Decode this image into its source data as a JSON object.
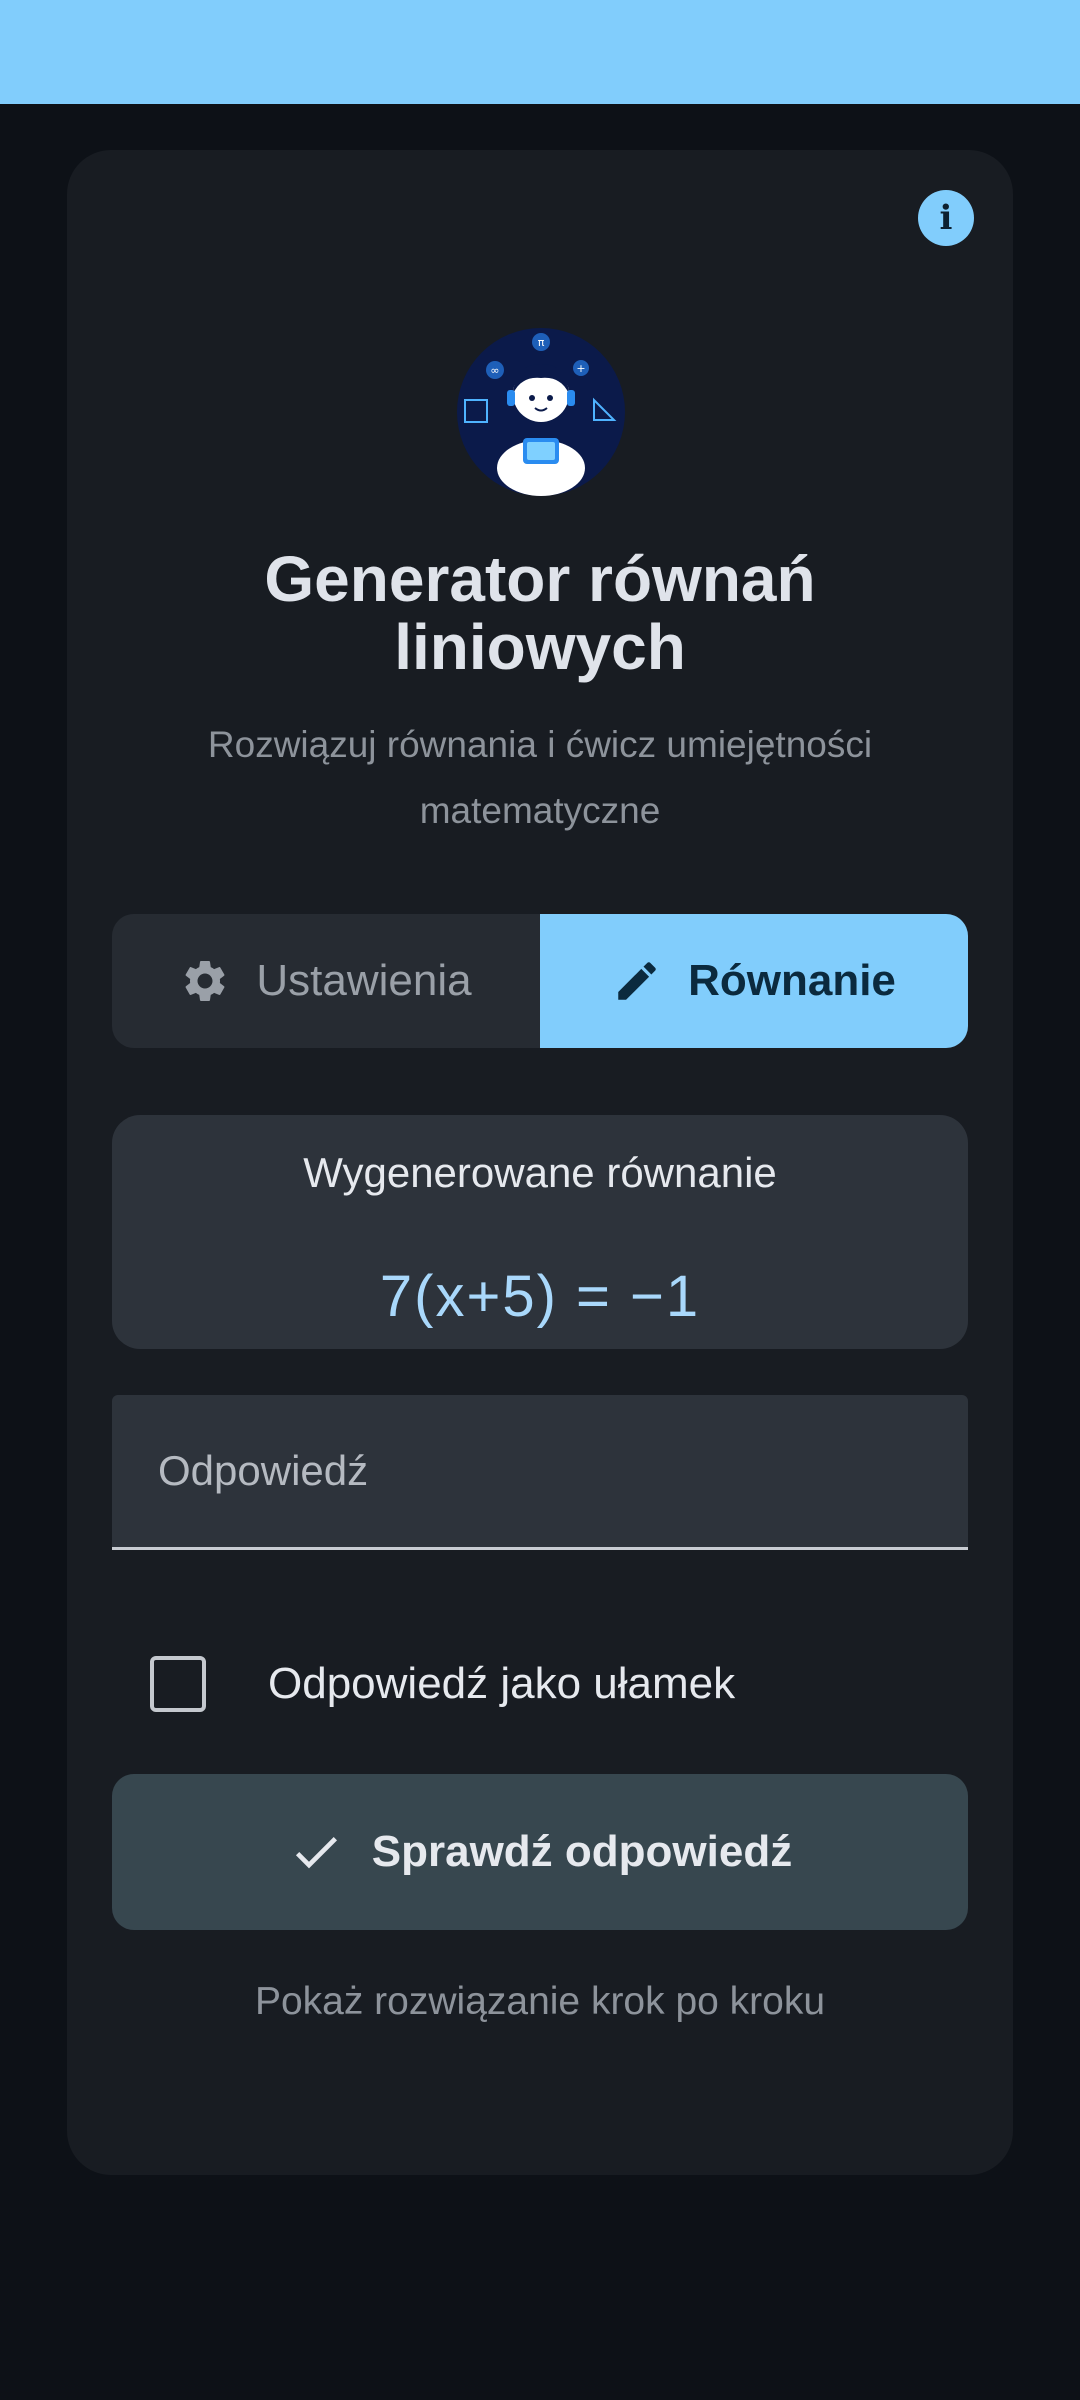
{
  "colors": {
    "accent": "#81cdfc",
    "background": "#0d1117",
    "card": "#181c22",
    "surface": "#2d333b",
    "button": "#37474f"
  },
  "header": {
    "title": "Generator równań liniowych",
    "subtitle": "Rozwiązuj równania i ćwicz umiejętności matematyczne",
    "info_icon": "info-icon",
    "info_glyph": "i"
  },
  "tabs": [
    {
      "label": "Ustawienia",
      "icon": "gear-icon",
      "selected": false
    },
    {
      "label": "Równanie",
      "icon": "pencil-icon",
      "selected": true
    }
  ],
  "equation": {
    "label": "Wygenerowane równanie",
    "value": "7(x+5) = −1"
  },
  "answer": {
    "placeholder": "Odpowiedź",
    "value": ""
  },
  "fraction_option": {
    "label": "Odpowiedź jako ułamek",
    "checked": false
  },
  "check_button": {
    "label": "Sprawdź odpowiedź",
    "icon": "checkmark-icon"
  },
  "steps_link": {
    "label": "Pokaż rozwiązanie krok po kroku"
  }
}
